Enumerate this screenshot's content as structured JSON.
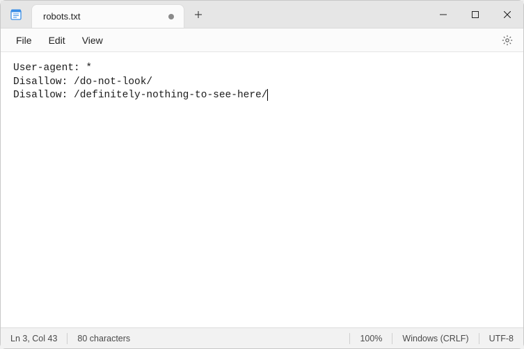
{
  "tab": {
    "title": "robots.txt"
  },
  "menu": {
    "file": "File",
    "edit": "Edit",
    "view": "View"
  },
  "content": {
    "line1": "User-agent: *",
    "line2": "Disallow: /do-not-look/",
    "line3": "Disallow: /definitely-nothing-to-see-here/"
  },
  "status": {
    "position": "Ln 3, Col 43",
    "chars": "80 characters",
    "zoom": "100%",
    "line_ending": "Windows (CRLF)",
    "encoding": "UTF-8"
  }
}
